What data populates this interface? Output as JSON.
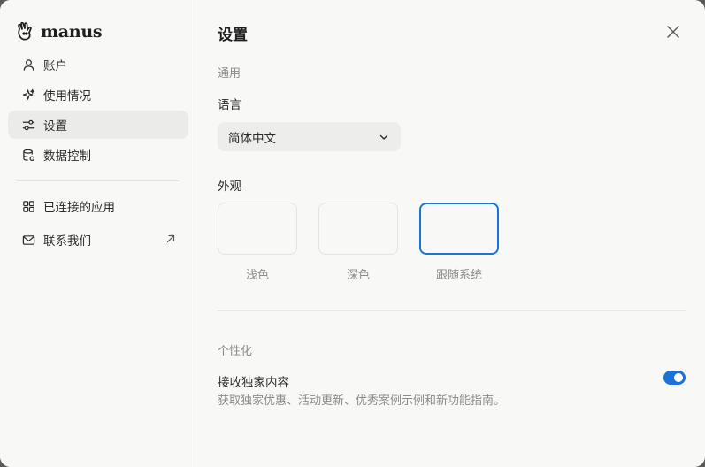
{
  "app": {
    "logo_text": "manus"
  },
  "sidebar": {
    "items": [
      {
        "label": "账户",
        "icon": "user-icon",
        "active": false
      },
      {
        "label": "使用情况",
        "icon": "sparkle-icon",
        "active": false
      },
      {
        "label": "设置",
        "icon": "sliders-icon",
        "active": true
      },
      {
        "label": "数据控制",
        "icon": "database-icon",
        "active": false
      }
    ],
    "items2": [
      {
        "label": "已连接的应用",
        "icon": "grid-icon"
      },
      {
        "label": "联系我们",
        "icon": "mail-icon",
        "external_icon": "arrow-up-right-icon"
      }
    ]
  },
  "main": {
    "title": "设置",
    "general_section": "通用",
    "language_label": "语言",
    "language_value": "简体中文",
    "appearance_label": "外观",
    "themes": [
      {
        "label": "浅色",
        "selected": false
      },
      {
        "label": "深色",
        "selected": false
      },
      {
        "label": "跟随系统",
        "selected": true
      }
    ],
    "personalization_section": "个性化",
    "exclusive_label": "接收独家内容",
    "exclusive_desc": "获取独家优惠、活动更新、优秀案例示例和新功能指南。",
    "exclusive_enabled": true
  },
  "colors": {
    "accent": "#1a73d9",
    "background": "#f8f8f7",
    "active_nav": "#ebebe9"
  }
}
